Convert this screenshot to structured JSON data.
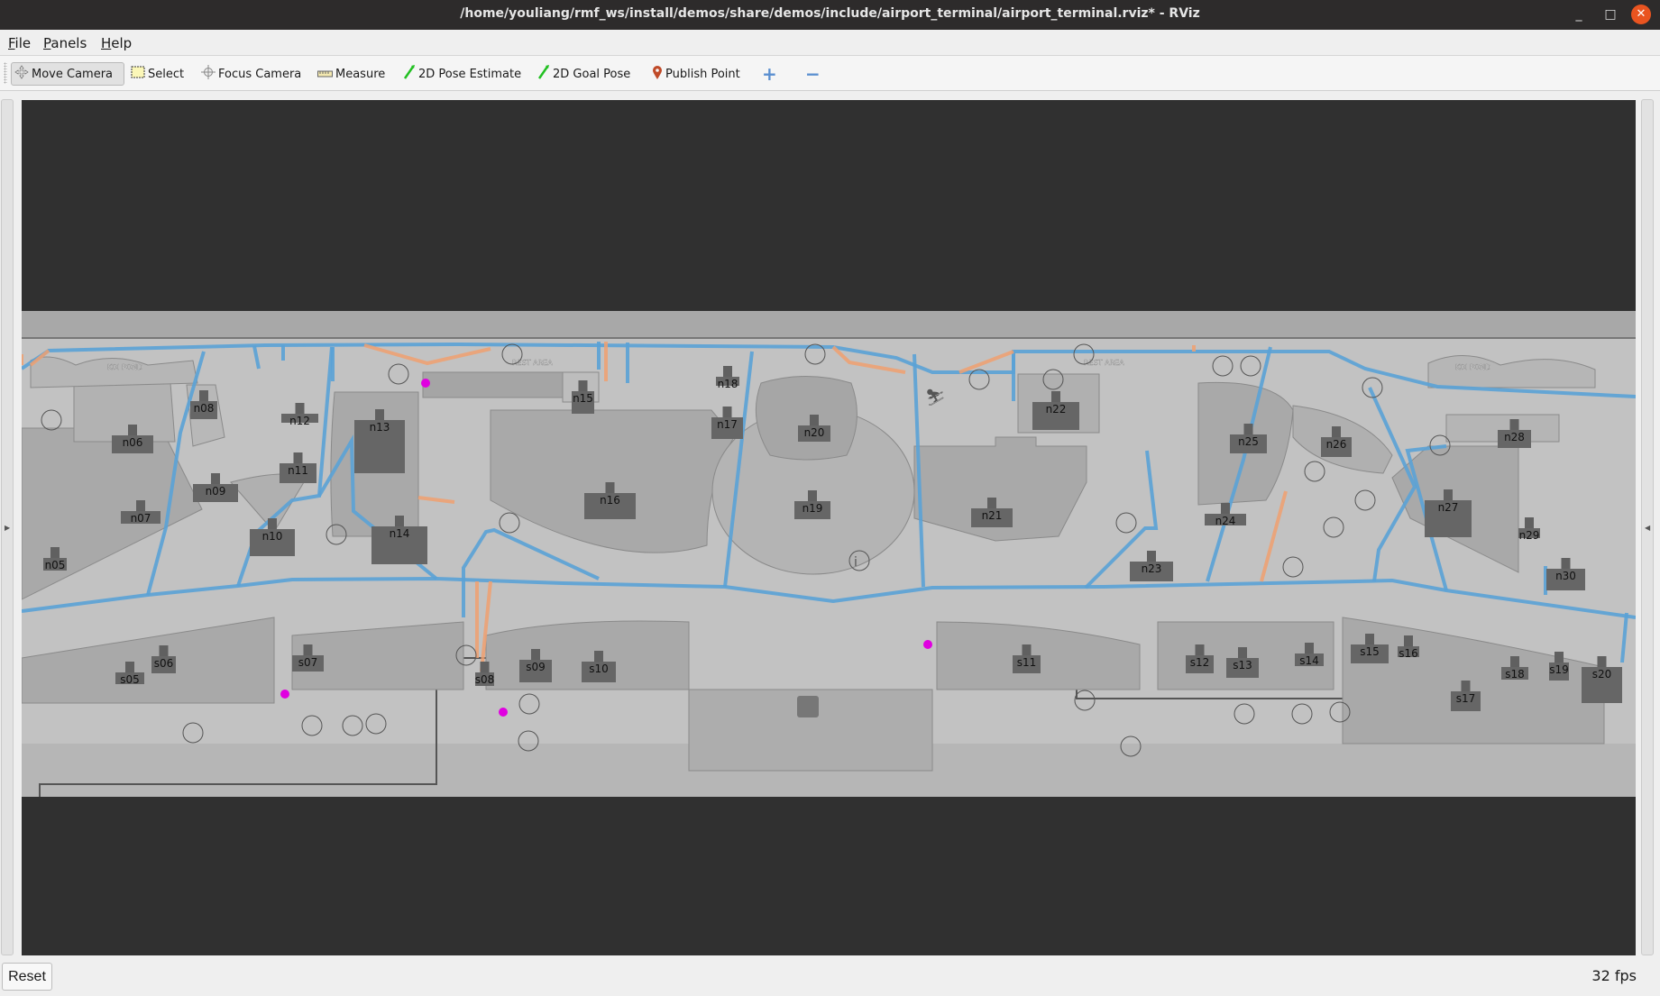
{
  "window": {
    "title": "/home/youliang/rmf_ws/install/demos/share/demos/include/airport_terminal/airport_terminal.rviz* - RViz",
    "minimize_label": "_",
    "maximize_label": "□",
    "close_label": "✕"
  },
  "menubar": {
    "items": [
      {
        "label": "File",
        "mnemonic": "F",
        "rest": "ile"
      },
      {
        "label": "Panels",
        "mnemonic": "P",
        "rest": "anels"
      },
      {
        "label": "Help",
        "mnemonic": "H",
        "rest": "elp"
      }
    ]
  },
  "toolbar": {
    "tools": [
      {
        "label": "Move Camera",
        "icon": "move-camera-icon",
        "active": true
      },
      {
        "label": "Select",
        "icon": "select-box-icon",
        "active": false
      },
      {
        "label": "Focus Camera",
        "icon": "focus-camera-icon",
        "active": false
      },
      {
        "label": "Measure",
        "icon": "ruler-icon",
        "active": false
      },
      {
        "label": "2D Pose Estimate",
        "icon": "green-arrow-icon",
        "active": false
      },
      {
        "label": "2D Goal Pose",
        "icon": "green-arrow-icon",
        "active": false
      },
      {
        "label": "Publish Point",
        "icon": "map-pin-icon",
        "active": false
      }
    ],
    "add_tool_label": "+",
    "remove_tool_label": "−"
  },
  "viewport": {
    "background": "#303030",
    "map": {
      "lane_color": "#5aa2d6",
      "lane_alt_color": "#f0a070",
      "waypoint_color": "#e000e0",
      "label_bg": "#666666",
      "north_stores": [
        "n05",
        "n06",
        "n07",
        "n08",
        "n09",
        "n10",
        "n11",
        "n12",
        "n13",
        "n14",
        "n15",
        "n16",
        "n17",
        "n18",
        "n19",
        "n20",
        "n21",
        "n22",
        "n23",
        "n24",
        "n25",
        "n26",
        "n27",
        "n28",
        "n29",
        "n30"
      ],
      "south_stores": [
        "s05",
        "s06",
        "s07",
        "s08",
        "s09",
        "s10",
        "s11",
        "s12",
        "s13",
        "s14",
        "s15",
        "s16",
        "s17",
        "s18",
        "s19",
        "s20"
      ],
      "area_labels": [
        "KOI POND",
        "REST AREA",
        "REST AREA",
        "KOI POND"
      ]
    }
  },
  "statusbar": {
    "reset_label": "Reset",
    "fps_text": "32 fps"
  }
}
